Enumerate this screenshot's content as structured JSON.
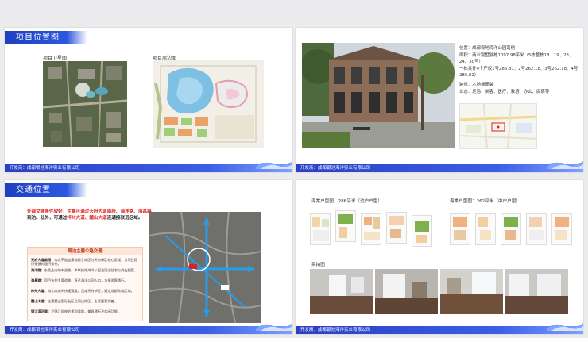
{
  "slides": {
    "location": {
      "title": "项目位置图",
      "satellite_caption": "项目卫星图",
      "surroundings_caption": "项目周边图",
      "footer": "开发商：成都银池海洋实业有限公司"
    },
    "info": {
      "location": "位置：成都极地海洋公园南侧",
      "area": "面积：商业别墅独栋1097.98平米（5栋整栋18、19、23、24、30号）",
      "units": "一栋共计4个产权1号286.81、2号262.18、3号262.18、4号286.81）",
      "decoration": "装修：木地板简装",
      "business": "业态：足浴、美容、医疗、教培、办公、民宿等",
      "footer": "开发商：成都银池海洋实业有限公司"
    },
    "traffic": {
      "title": "交通位置",
      "desc_1": "外部交通条件较好，主要可通过",
      "desc_highlight_1": "天府大道南段、",
      "desc_highlight_2": "海洋路、海昌路",
      "desc_2": "到达。此外，可通过",
      "desc_highlight_3": "梓州大道、",
      "desc_highlight_4": "麓山大道",
      "desc_3": "连通接驳远区域。",
      "box_title": "周边主要公路交通",
      "roads": [
        {
          "name": "天府大道南段：",
          "text": "南北干道连接成都主城区与天府新区核心区域，为项目提供便捷的通行条件。"
        },
        {
          "name": "海洋路：",
          "text": "东西走向城市道路，串联极地海洋公园及周边住宅与商业配套。"
        },
        {
          "name": "海昌路：",
          "text": "项目东侧主要道路，直达海洋公园入口，方便游客通行。"
        },
        {
          "name": "梓州大道：",
          "text": "南北向城市快速通道，贯穿天府新区，通达成都东南区域。"
        },
        {
          "name": "麓山大道：",
          "text": "连通麓山国际社区及周边片区，生活配套完善。"
        },
        {
          "name": "锦江滨河道：",
          "text": "沿锦江延伸的景观道路，兼具通行及休闲功能。"
        }
      ],
      "footer": "开发商：成都银池海洋实业有限公司"
    },
    "floorplans": {
      "type_a": "海棠户型图：286平米（边户户型）",
      "type_b": "海棠户型图：262平米（中户户型）",
      "photos_caption": "实拍图",
      "footer": "开发商：成都银池海洋实业有限公司"
    }
  },
  "colors": {
    "accent_blue": "#2b57e0",
    "highlight_red": "#e0201a"
  }
}
